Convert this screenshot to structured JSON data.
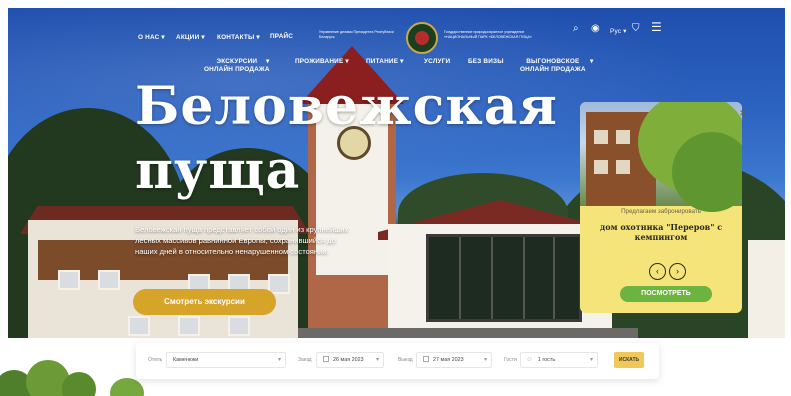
{
  "nav": {
    "top": [
      {
        "label": "О НАС",
        "caret": "▾"
      },
      {
        "label": "АКЦИИ",
        "caret": "▾"
      },
      {
        "label": "КОНТАКТЫ",
        "caret": "▾"
      },
      {
        "label": "ПРАЙС",
        "caret": ""
      }
    ],
    "admin_org": "Управление делами Президента Республики Беларусь",
    "park_org": "Государственное природоохранное учреждение «НАЦИОНАЛЬНЫЙ ПАРК «БЕЛОВЕЖСКАЯ ПУЩА»",
    "lang": "Рус",
    "main": [
      {
        "label": "ЭКСКУРСИИ\nОНЛАЙН ПРОДАЖА"
      },
      {
        "label": "ПРОЖИВАНИЕ"
      },
      {
        "label": "ПИТАНИЕ"
      },
      {
        "label": "УСЛУГИ"
      },
      {
        "label": "БЕЗ ВИЗЫ"
      },
      {
        "label": "ВЫГОНОВСКОЕ\nОНЛАЙН ПРОДАЖА"
      }
    ],
    "icons": [
      "search-icon",
      "eye-icon",
      "cart-icon",
      "menu-icon"
    ]
  },
  "hero": {
    "title_line1": "Беловежская",
    "title_line2": "пуща",
    "text": "Беловежская пуща представляет собой один из крупнейших лесных массивов равнинной Европы, сохранившийся до наших дней в относительно ненарушенном состоянии.",
    "cta": "Смотреть экскурсии"
  },
  "card": {
    "label": "Предлагаем забронировать",
    "title": "дом охотника \"Переров\" с кемпингом",
    "prev": "‹",
    "next": "›",
    "button": "ПОСМОТРЕТЬ",
    "close": "✕"
  },
  "booking": {
    "hotel_label": "Отель",
    "hotel_value": "Каменюки",
    "checkin_label": "Заезд",
    "checkin_value": "26 мая 2023",
    "checkout_label": "Выезд",
    "checkout_value": "27 мая 2023",
    "guests_label": "Гости",
    "guests_value": "1 гость",
    "search": "ИСКАТЬ"
  },
  "colors": {
    "accent": "#d5a428",
    "card_bg": "#f4e47a",
    "view_button": "#6db33f",
    "search_button": "#f0c85a"
  }
}
